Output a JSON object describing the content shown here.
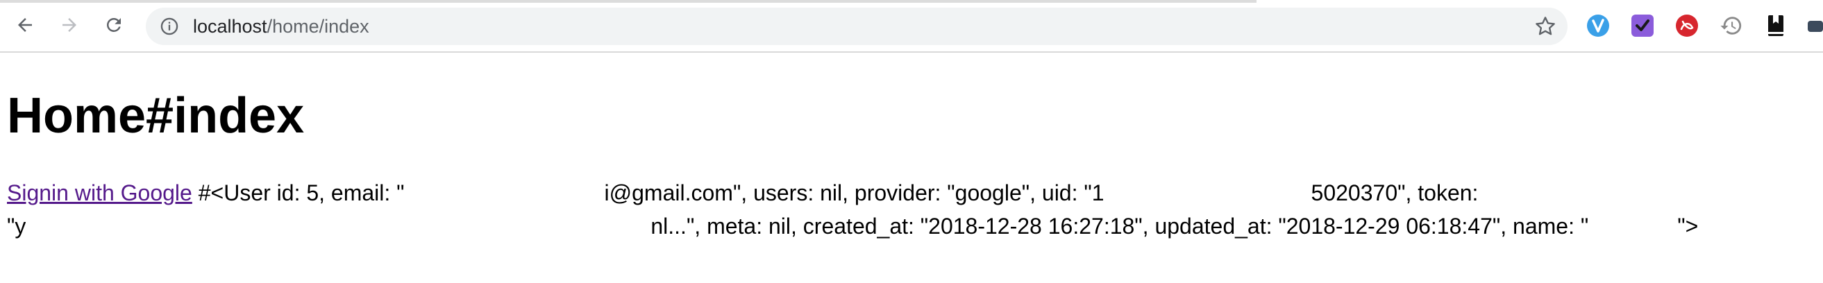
{
  "browser": {
    "url_host": "localhost",
    "url_path": "/home/index"
  },
  "page": {
    "heading": "Home#index",
    "signin_link": "Signin with Google",
    "line1": {
      "seg1": " #<User id: 5, email: \"",
      "seg2": "i@gmail.com\", users: nil, provider: \"google\", uid: \"1",
      "seg3": "5020370\", token:"
    },
    "line2": {
      "seg1": "\"y",
      "seg2": "nl...\", meta: nil, created_at: \"2018-12-28 16:27:18\", updated_at: \"2018-12-29 06:18:47\", name: \"",
      "seg3": "\">"
    }
  },
  "colors": {
    "link_visited": "#551a8b",
    "omnibox_bg": "#f1f3f4"
  }
}
